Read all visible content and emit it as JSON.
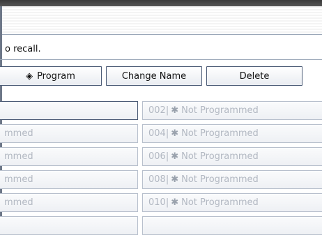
{
  "instruction_text": "o recall.",
  "toolbar": {
    "program_label": "Program",
    "program_icon": "program-icon",
    "change_name_label": "Change Name",
    "delete_label": "Delete"
  },
  "slots": {
    "left": [
      "",
      "mmed",
      "mmed",
      "mmed",
      "mmed"
    ],
    "right": [
      {
        "number": "002",
        "label": "Not Programmed"
      },
      {
        "number": "004",
        "label": "Not Programmed"
      },
      {
        "number": "006",
        "label": "Not Programmed"
      },
      {
        "number": "008",
        "label": "Not Programmed"
      },
      {
        "number": "010",
        "label": "Not Programmed"
      }
    ],
    "separator": "|",
    "star": "✱"
  },
  "colors": {
    "button_border": "#4a5a75",
    "slot_text": "#b2b8c2",
    "top_bar": "#3a3a3a"
  }
}
